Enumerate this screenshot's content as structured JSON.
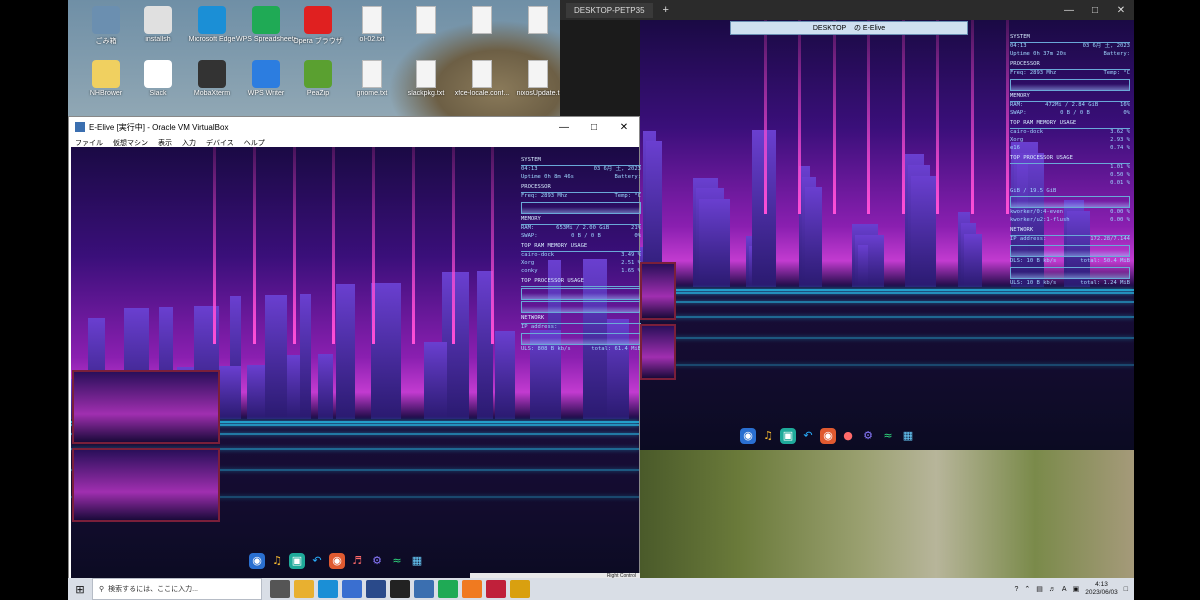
{
  "desktop": {
    "icons": [
      {
        "label": "ごみ箱",
        "color": "#6b8fb0"
      },
      {
        "label": "installsh",
        "color": "#e0e0e0"
      },
      {
        "label": "Microsoft Edge",
        "color": "#1b8fd6"
      },
      {
        "label": "WPS Spreadsheets",
        "color": "#1faa55"
      },
      {
        "label": "Opera ブラウザ",
        "color": "#e02020"
      },
      {
        "label": "ol-02.txt",
        "color": "#f4f4f4"
      },
      {
        "label": "",
        "color": "#f4f4f4"
      },
      {
        "label": "",
        "color": "#f4f4f4"
      },
      {
        "label": "",
        "color": "#f4f4f4"
      },
      {
        "label": "NHBrower",
        "color": "#f0d060"
      },
      {
        "label": "Slack",
        "color": "#ffffff"
      },
      {
        "label": "MobaXterm",
        "color": "#333333"
      },
      {
        "label": "WPS Writer",
        "color": "#2c7de0"
      },
      {
        "label": "PeaZip",
        "color": "#5aa030"
      },
      {
        "label": "gnome.txt",
        "color": "#f4f4f4"
      },
      {
        "label": "slackpkg.txt",
        "color": "#f4f4f4"
      },
      {
        "label": "xfce-locale.conf...",
        "color": "#f4f4f4"
      },
      {
        "label": "nixosUpdate.t",
        "color": "#f4f4f4"
      }
    ]
  },
  "vm_window": {
    "title": "E-Elive [実行中] - Oracle VM VirtualBox",
    "menu": [
      "ファイル",
      "仮想マシン",
      "表示",
      "入力",
      "デバイス",
      "ヘルプ"
    ],
    "status_right": "Right Control"
  },
  "vm_monitor": {
    "system_header": "SYSTEM",
    "time": "04:13",
    "date": "03 6月 土, 2023",
    "uptime": "Uptime 0h 8m 46s",
    "battery": "Battery:",
    "processor_header": "PROCESSOR",
    "freq": "Freq: 2893 Mhz",
    "temp": "Temp: °C",
    "memory_header": "MEMORY",
    "ram": "RAM:",
    "ram_value": "653Mi / 2.00 GiB",
    "ram_pct": "21%",
    "swap": "SWAP:",
    "swap_value": "0 B / 0 B",
    "swap_pct": "0%",
    "top_ram_header": "TOP RAM MEMORY USAGE",
    "top_ram": [
      {
        "name": "cairo-dock",
        "value": "3.49 %"
      },
      {
        "name": "Xorg",
        "value": "2.51 %"
      },
      {
        "name": "conky",
        "value": "1.65 %"
      }
    ],
    "top_proc_header": "TOP PROCESSOR USAGE",
    "network_header": "NETWORK",
    "ip_label": "IP address:",
    "uls": "ULS: 808 B kb/s",
    "total": "total: 61.4 MiB"
  },
  "remote_window": {
    "tab_title": "DESKTOP-PETP35",
    "new_tab": "+",
    "connection_bar": "DESKTOP",
    "connection_bar_2": "の E-Elive"
  },
  "remote_monitor": {
    "system_header": "SYSTEM",
    "time": "04:13",
    "date": "03 6月 土, 2023",
    "uptime": "Uptime 0h 37m 20s",
    "battery": "Battery:",
    "processor_header": "PROCESSOR",
    "freq": "Freq: 2893 Mhz",
    "temp": "Temp: °C",
    "memory_header": "MEMORY",
    "ram": "RAM:",
    "ram_value": "472Mi / 2.84 GiB",
    "ram_pct": "16%",
    "swap": "SWAP:",
    "swap_value": "0 B / 0 B",
    "swap_pct": "0%",
    "top_ram_header": "TOP RAM MEMORY USAGE",
    "top_ram": [
      {
        "name": "cairo-dock",
        "value": "3.62 %"
      },
      {
        "name": "Xorg",
        "value": "2.93 %"
      },
      {
        "name": "e16",
        "value": "0.74 %"
      }
    ],
    "top_proc_header": "TOP PROCESSOR USAGE",
    "top_proc": [
      {
        "name": "",
        "value": "1.01 %"
      },
      {
        "name": "",
        "value": "0.50 %"
      },
      {
        "name": "",
        "value": "0.01 %"
      }
    ],
    "disk_value": "GiB / 19.5 GiB",
    "kworker1": "kworker/0:4-even",
    "kworker1_val": "0.00 %",
    "kworker2": "kworker/u2:1-flush",
    "kworker2_val": "0.00 %",
    "network_header": "NETWORK",
    "ip_label": "IP address:",
    "ip_value": "172.28/7.144",
    "dls": "DLS: 10 B kb/s",
    "dls_total": "total: 50.4 MiB",
    "uls": "ULS: 10 B kb/s",
    "uls_total": "total: 1.24 MiB"
  },
  "taskbar": {
    "search_placeholder": "検索するには、ここに入力...",
    "apps": [
      {
        "icon": "task-view",
        "color": "#555555"
      },
      {
        "icon": "folder",
        "color": "#e8b030"
      },
      {
        "icon": "edge",
        "color": "#1b8fd6"
      },
      {
        "icon": "store",
        "color": "#3a6fd0"
      },
      {
        "icon": "powershell",
        "color": "#2a4a8a"
      },
      {
        "icon": "terminal",
        "color": "#222222"
      },
      {
        "icon": "virtualbox",
        "color": "#3b6fb0"
      },
      {
        "icon": "wps",
        "color": "#1faa55"
      },
      {
        "icon": "app-orange",
        "color": "#f07a20"
      },
      {
        "icon": "recorder",
        "color": "#c0203a"
      },
      {
        "icon": "filezilla",
        "color": "#d9a010"
      }
    ],
    "lang": "A",
    "time": "4:13",
    "date": "2023/06/03"
  }
}
